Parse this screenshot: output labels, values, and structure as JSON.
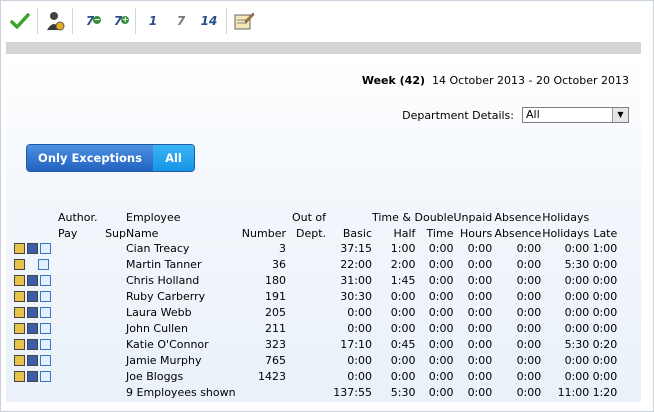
{
  "toolbar": {
    "buttons": [
      {
        "name": "approve-button",
        "icon": "green-checkmark-icon"
      },
      {
        "name": "employee-button",
        "icon": "person-edit-icon"
      },
      {
        "name": "prev-7-button",
        "label": "7",
        "mark": "−"
      },
      {
        "name": "next-7-button",
        "label": "7",
        "mark": "+"
      },
      {
        "name": "view-1-button",
        "label": "1"
      },
      {
        "name": "view-7-button",
        "label": "7"
      },
      {
        "name": "view-14-button",
        "label": "14"
      },
      {
        "name": "report-button",
        "icon": "notepad-pencil-icon"
      }
    ]
  },
  "week": {
    "label": "Week (42)",
    "range": "14 October 2013 - 20 October 2013"
  },
  "department": {
    "label": "Department Details:",
    "selected": "All"
  },
  "filter": {
    "exceptions_label": "Only Exceptions",
    "all_label": "All"
  },
  "table": {
    "head1": [
      "Author.",
      "Employee",
      "Out of",
      "Time & Double",
      "Unpaid",
      "Absence",
      "Holidays"
    ],
    "head2": [
      "Pay",
      "Sup",
      "Name",
      "Number",
      "Dept.",
      "Basic",
      "Half",
      "Time",
      "Hours",
      "Absence",
      "Holidays",
      "Late"
    ],
    "rows": [
      {
        "name": "Cian Treacy",
        "number": "3",
        "basic": "37:15",
        "half": "1:00",
        "dbl": "0:00",
        "unpaid": "0:00",
        "absence": "0:00",
        "holidays": "0:00",
        "late": "1:00",
        "sup": true
      },
      {
        "name": "Martin Tanner",
        "number": "36",
        "basic": "22:00",
        "half": "2:00",
        "dbl": "0:00",
        "unpaid": "0:00",
        "absence": "0:00",
        "holidays": "5:30",
        "late": "0:00",
        "sup": false
      },
      {
        "name": "Chris Holland",
        "number": "180",
        "basic": "31:00",
        "half": "1:45",
        "dbl": "0:00",
        "unpaid": "0:00",
        "absence": "0:00",
        "holidays": "0:00",
        "late": "0:00",
        "sup": true
      },
      {
        "name": "Ruby Carberry",
        "number": "191",
        "basic": "30:30",
        "half": "0:00",
        "dbl": "0:00",
        "unpaid": "0:00",
        "absence": "0:00",
        "holidays": "0:00",
        "late": "0:00",
        "sup": true
      },
      {
        "name": "Laura Webb",
        "number": "205",
        "basic": "0:00",
        "half": "0:00",
        "dbl": "0:00",
        "unpaid": "0:00",
        "absence": "0:00",
        "holidays": "0:00",
        "late": "0:00",
        "sup": true
      },
      {
        "name": "John Cullen",
        "number": "211",
        "basic": "0:00",
        "half": "0:00",
        "dbl": "0:00",
        "unpaid": "0:00",
        "absence": "0:00",
        "holidays": "0:00",
        "late": "0:00",
        "sup": true
      },
      {
        "name": "Katie O'Connor",
        "number": "323",
        "basic": "17:10",
        "half": "0:45",
        "dbl": "0:00",
        "unpaid": "0:00",
        "absence": "0:00",
        "holidays": "5:30",
        "late": "0:20",
        "sup": true
      },
      {
        "name": "Jamie Murphy",
        "number": "765",
        "basic": "0:00",
        "half": "0:00",
        "dbl": "0:00",
        "unpaid": "0:00",
        "absence": "0:00",
        "holidays": "0:00",
        "late": "0:00",
        "sup": true
      },
      {
        "name": "Joe Bloggs",
        "number": "1423",
        "basic": "0:00",
        "half": "0:00",
        "dbl": "0:00",
        "unpaid": "0:00",
        "absence": "0:00",
        "holidays": "0:00",
        "late": "0:00",
        "sup": true
      }
    ],
    "total": {
      "label": "9 Employees shown",
      "basic": "137:55",
      "half": "5:30",
      "dbl": "0:00",
      "unpaid": "0:00",
      "absence": "0:00",
      "holidays": "11:00",
      "late": "1:20"
    }
  }
}
